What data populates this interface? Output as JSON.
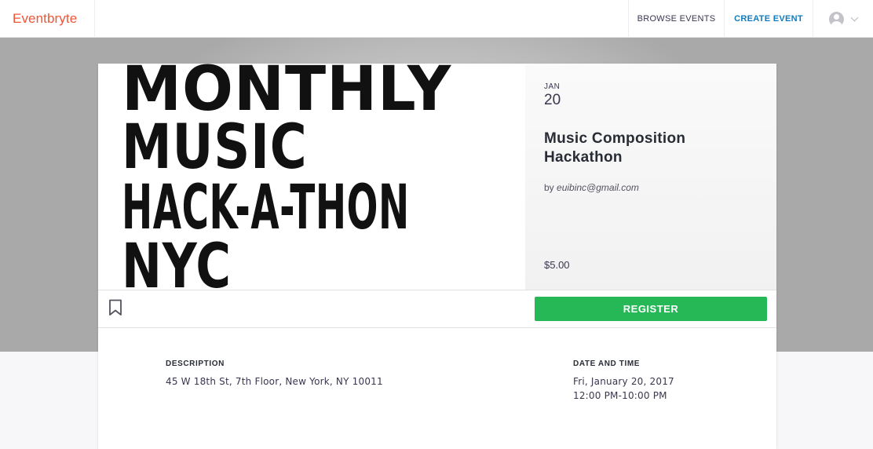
{
  "nav": {
    "logo": "Eventbryte",
    "browse_events": "BROWSE EVENTS",
    "create_event": "CREATE EVENT"
  },
  "event": {
    "poster_lines": [
      "MONTHLY",
      "MUSIC",
      "HACK-A-THON",
      "NYC"
    ],
    "month": "JAN",
    "day": "20",
    "title": "Music Composition Hackathon",
    "by_prefix": "by ",
    "organizer": "euibinc@gmail.com",
    "price": "$5.00",
    "register_label": "REGISTER"
  },
  "details": {
    "description_label": "DESCRIPTION",
    "description_text": "45 W 18th St, 7th Floor, New York, NY 10011",
    "datetime_label": "DATE AND TIME",
    "date_text": "Fri, January 20, 2017",
    "time_text": "12:00 PM-10:00 PM"
  },
  "colors": {
    "brand": "#f05537",
    "link": "#0f7bbd",
    "register": "#26b856"
  }
}
